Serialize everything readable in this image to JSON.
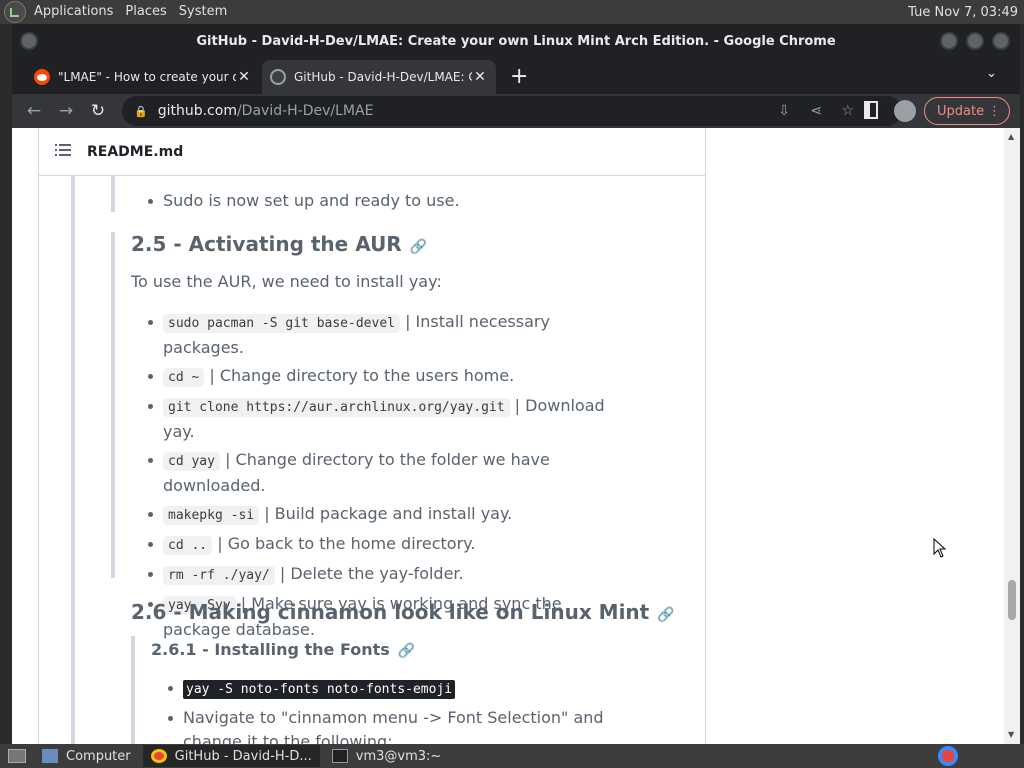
{
  "top_panel": {
    "menus": [
      "Applications",
      "Places",
      "System"
    ],
    "clock": "Tue Nov 7, 03:49"
  },
  "window": {
    "title": "GitHub - David-H-Dev/LMAE: Create your own Linux Mint Arch Edition. - Google Chrome"
  },
  "tabs": [
    {
      "label": "\"LMAE\" - How to create your own Linux Mint Arch Edition",
      "favicon": "reddit-icon"
    },
    {
      "label": "GitHub - David-H-Dev/LMAE: Create your own Linux Mint Arch Edition",
      "favicon": "github-icon"
    }
  ],
  "toolbar": {
    "url_host": "github.com",
    "url_path": "/David-H-Dev/LMAE",
    "update_label": "Update"
  },
  "readme": {
    "filename": "README.md",
    "top_item": "Sudo is now set up and ready to use.",
    "sec25": {
      "heading": "2.5 - Activating the AUR",
      "intro": "To use the AUR, we need to install yay:",
      "items": [
        {
          "code": "sudo pacman -S git base-devel",
          "text": "| Install necessary packages."
        },
        {
          "code": "cd ~",
          "text": "| Change directory to the users home."
        },
        {
          "code": "git clone https://aur.archlinux.org/yay.git",
          "text": "| Download yay."
        },
        {
          "code": "cd yay",
          "text": "| Change directory to the folder we have downloaded."
        },
        {
          "code": "makepkg -si",
          "text": "| Build package and install yay."
        },
        {
          "code": "cd ..",
          "text": "| Go back to the home directory."
        },
        {
          "code": "rm -rf ./yay/",
          "text": "| Delete the yay-folder."
        },
        {
          "code": "yay -Syy",
          "text": "| Make sure yay is working and sync the package database."
        }
      ]
    },
    "sec26": {
      "heading": "2.6 - Making cinnamon look like on Linux Mint",
      "sub_heading": "2.6.1 - Installing the Fonts",
      "items": [
        {
          "code": "yay -S noto-fonts noto-fonts-emoji"
        },
        {
          "text": "Navigate to \"cinnamon menu -> Font Selection\" and change it to the following:"
        }
      ]
    }
  },
  "taskbar": {
    "items": [
      {
        "label": "Computer"
      },
      {
        "label": "GitHub - David-H-D..."
      },
      {
        "label": "vm3@vm3:~"
      }
    ]
  }
}
